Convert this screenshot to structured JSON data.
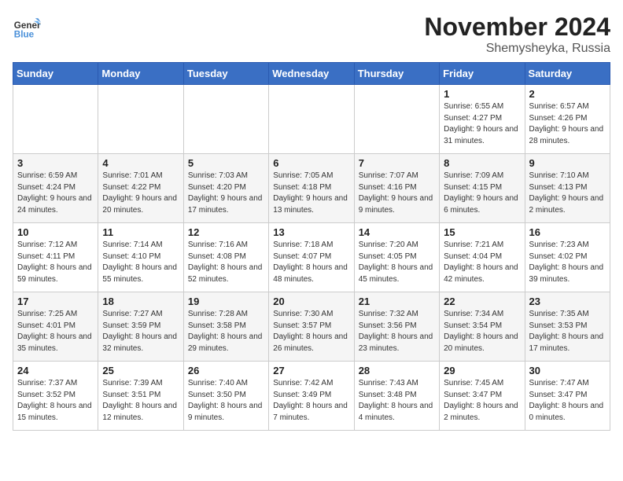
{
  "logo": {
    "line1": "General",
    "line2": "Blue"
  },
  "title": "November 2024",
  "subtitle": "Shemysheyka, Russia",
  "days_header": [
    "Sunday",
    "Monday",
    "Tuesday",
    "Wednesday",
    "Thursday",
    "Friday",
    "Saturday"
  ],
  "weeks": [
    [
      {
        "day": "",
        "info": ""
      },
      {
        "day": "",
        "info": ""
      },
      {
        "day": "",
        "info": ""
      },
      {
        "day": "",
        "info": ""
      },
      {
        "day": "",
        "info": ""
      },
      {
        "day": "1",
        "info": "Sunrise: 6:55 AM\nSunset: 4:27 PM\nDaylight: 9 hours\nand 31 minutes."
      },
      {
        "day": "2",
        "info": "Sunrise: 6:57 AM\nSunset: 4:26 PM\nDaylight: 9 hours\nand 28 minutes."
      }
    ],
    [
      {
        "day": "3",
        "info": "Sunrise: 6:59 AM\nSunset: 4:24 PM\nDaylight: 9 hours\nand 24 minutes."
      },
      {
        "day": "4",
        "info": "Sunrise: 7:01 AM\nSunset: 4:22 PM\nDaylight: 9 hours\nand 20 minutes."
      },
      {
        "day": "5",
        "info": "Sunrise: 7:03 AM\nSunset: 4:20 PM\nDaylight: 9 hours\nand 17 minutes."
      },
      {
        "day": "6",
        "info": "Sunrise: 7:05 AM\nSunset: 4:18 PM\nDaylight: 9 hours\nand 13 minutes."
      },
      {
        "day": "7",
        "info": "Sunrise: 7:07 AM\nSunset: 4:16 PM\nDaylight: 9 hours\nand 9 minutes."
      },
      {
        "day": "8",
        "info": "Sunrise: 7:09 AM\nSunset: 4:15 PM\nDaylight: 9 hours\nand 6 minutes."
      },
      {
        "day": "9",
        "info": "Sunrise: 7:10 AM\nSunset: 4:13 PM\nDaylight: 9 hours\nand 2 minutes."
      }
    ],
    [
      {
        "day": "10",
        "info": "Sunrise: 7:12 AM\nSunset: 4:11 PM\nDaylight: 8 hours\nand 59 minutes."
      },
      {
        "day": "11",
        "info": "Sunrise: 7:14 AM\nSunset: 4:10 PM\nDaylight: 8 hours\nand 55 minutes."
      },
      {
        "day": "12",
        "info": "Sunrise: 7:16 AM\nSunset: 4:08 PM\nDaylight: 8 hours\nand 52 minutes."
      },
      {
        "day": "13",
        "info": "Sunrise: 7:18 AM\nSunset: 4:07 PM\nDaylight: 8 hours\nand 48 minutes."
      },
      {
        "day": "14",
        "info": "Sunrise: 7:20 AM\nSunset: 4:05 PM\nDaylight: 8 hours\nand 45 minutes."
      },
      {
        "day": "15",
        "info": "Sunrise: 7:21 AM\nSunset: 4:04 PM\nDaylight: 8 hours\nand 42 minutes."
      },
      {
        "day": "16",
        "info": "Sunrise: 7:23 AM\nSunset: 4:02 PM\nDaylight: 8 hours\nand 39 minutes."
      }
    ],
    [
      {
        "day": "17",
        "info": "Sunrise: 7:25 AM\nSunset: 4:01 PM\nDaylight: 8 hours\nand 35 minutes."
      },
      {
        "day": "18",
        "info": "Sunrise: 7:27 AM\nSunset: 3:59 PM\nDaylight: 8 hours\nand 32 minutes."
      },
      {
        "day": "19",
        "info": "Sunrise: 7:28 AM\nSunset: 3:58 PM\nDaylight: 8 hours\nand 29 minutes."
      },
      {
        "day": "20",
        "info": "Sunrise: 7:30 AM\nSunset: 3:57 PM\nDaylight: 8 hours\nand 26 minutes."
      },
      {
        "day": "21",
        "info": "Sunrise: 7:32 AM\nSunset: 3:56 PM\nDaylight: 8 hours\nand 23 minutes."
      },
      {
        "day": "22",
        "info": "Sunrise: 7:34 AM\nSunset: 3:54 PM\nDaylight: 8 hours\nand 20 minutes."
      },
      {
        "day": "23",
        "info": "Sunrise: 7:35 AM\nSunset: 3:53 PM\nDaylight: 8 hours\nand 17 minutes."
      }
    ],
    [
      {
        "day": "24",
        "info": "Sunrise: 7:37 AM\nSunset: 3:52 PM\nDaylight: 8 hours\nand 15 minutes."
      },
      {
        "day": "25",
        "info": "Sunrise: 7:39 AM\nSunset: 3:51 PM\nDaylight: 8 hours\nand 12 minutes."
      },
      {
        "day": "26",
        "info": "Sunrise: 7:40 AM\nSunset: 3:50 PM\nDaylight: 8 hours\nand 9 minutes."
      },
      {
        "day": "27",
        "info": "Sunrise: 7:42 AM\nSunset: 3:49 PM\nDaylight: 8 hours\nand 7 minutes."
      },
      {
        "day": "28",
        "info": "Sunrise: 7:43 AM\nSunset: 3:48 PM\nDaylight: 8 hours\nand 4 minutes."
      },
      {
        "day": "29",
        "info": "Sunrise: 7:45 AM\nSunset: 3:47 PM\nDaylight: 8 hours\nand 2 minutes."
      },
      {
        "day": "30",
        "info": "Sunrise: 7:47 AM\nSunset: 3:47 PM\nDaylight: 8 hours\nand 0 minutes."
      }
    ]
  ]
}
